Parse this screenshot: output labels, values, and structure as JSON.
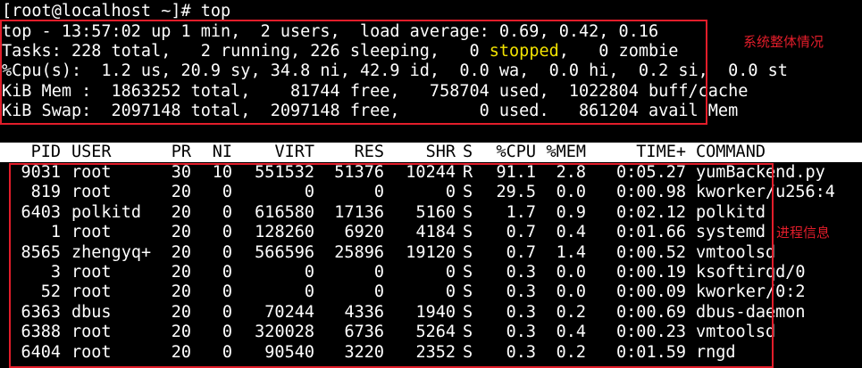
{
  "prompt": "[root@localhost ~]# top",
  "summary": {
    "top_line": "top - 13:57:02 up 1 min,  2 users,  load average: 0.69, 0.42, 0.16",
    "tasks_before": "Tasks: 228 total,   2 running, 226 sleeping,   0 ",
    "tasks_stopped": "stopped",
    "tasks_after": ",   0 zombie",
    "cpu_line": "%Cpu(s):  1.2 us, 20.9 sy, 34.8 ni, 42.9 id,  0.0 wa,  0.0 hi,  0.2 si,  0.0 st",
    "mem_line": "KiB Mem :  1863252 total,    81744 free,   758704 used,  1022804 buff/cache",
    "swap_line": "KiB Swap:  2097148 total,  2097148 free,        0 used.   861204 avail Mem"
  },
  "annotations": {
    "system_label": "系统整体情况",
    "process_label": "进程信息"
  },
  "columns": {
    "pid": "PID",
    "user": "USER",
    "pr": "PR",
    "ni": "NI",
    "virt": "VIRT",
    "res": "RES",
    "shr": "SHR",
    "s": "S",
    "cpu": "%CPU",
    "mem": "%MEM",
    "time": "TIME+",
    "command": "COMMAND"
  },
  "processes": [
    {
      "pid": "9031",
      "user": "root",
      "pr": "30",
      "ni": "10",
      "virt": "551532",
      "res": "51376",
      "shr": "10244",
      "s": "R",
      "cpu": "91.1",
      "mem": "2.8",
      "time": "0:05.27",
      "command": "yumBackend.py"
    },
    {
      "pid": "819",
      "user": "root",
      "pr": "20",
      "ni": "0",
      "virt": "0",
      "res": "0",
      "shr": "0",
      "s": "S",
      "cpu": "29.5",
      "mem": "0.0",
      "time": "0:00.98",
      "command": "kworker/u256:4"
    },
    {
      "pid": "6403",
      "user": "polkitd",
      "pr": "20",
      "ni": "0",
      "virt": "616580",
      "res": "17136",
      "shr": "5160",
      "s": "S",
      "cpu": "1.7",
      "mem": "0.9",
      "time": "0:02.12",
      "command": "polkitd"
    },
    {
      "pid": "1",
      "user": "root",
      "pr": "20",
      "ni": "0",
      "virt": "128260",
      "res": "6920",
      "shr": "4184",
      "s": "S",
      "cpu": "0.7",
      "mem": "0.4",
      "time": "0:01.66",
      "command": "systemd"
    },
    {
      "pid": "8565",
      "user": "zhengyq+",
      "pr": "20",
      "ni": "0",
      "virt": "566596",
      "res": "25896",
      "shr": "19120",
      "s": "S",
      "cpu": "0.7",
      "mem": "1.4",
      "time": "0:00.52",
      "command": "vmtoolsd"
    },
    {
      "pid": "3",
      "user": "root",
      "pr": "20",
      "ni": "0",
      "virt": "0",
      "res": "0",
      "shr": "0",
      "s": "S",
      "cpu": "0.3",
      "mem": "0.0",
      "time": "0:00.19",
      "command": "ksoftirqd/0"
    },
    {
      "pid": "52",
      "user": "root",
      "pr": "20",
      "ni": "0",
      "virt": "0",
      "res": "0",
      "shr": "0",
      "s": "S",
      "cpu": "0.3",
      "mem": "0.0",
      "time": "0:00.09",
      "command": "kworker/0:2"
    },
    {
      "pid": "6363",
      "user": "dbus",
      "pr": "20",
      "ni": "0",
      "virt": "70244",
      "res": "4336",
      "shr": "1940",
      "s": "S",
      "cpu": "0.3",
      "mem": "0.2",
      "time": "0:00.69",
      "command": "dbus-daemon"
    },
    {
      "pid": "6388",
      "user": "root",
      "pr": "20",
      "ni": "0",
      "virt": "320028",
      "res": "6736",
      "shr": "5264",
      "s": "S",
      "cpu": "0.3",
      "mem": "0.4",
      "time": "0:00.23",
      "command": "vmtoolsd"
    },
    {
      "pid": "6404",
      "user": "root",
      "pr": "20",
      "ni": "0",
      "virt": "90540",
      "res": "3220",
      "shr": "2352",
      "s": "S",
      "cpu": "0.3",
      "mem": "0.2",
      "time": "0:01.59",
      "command": "rngd"
    }
  ],
  "colors": {
    "background": "#000000",
    "text": "#ffffff",
    "highlight": "#f2e200",
    "annotation": "#e21d2a"
  }
}
